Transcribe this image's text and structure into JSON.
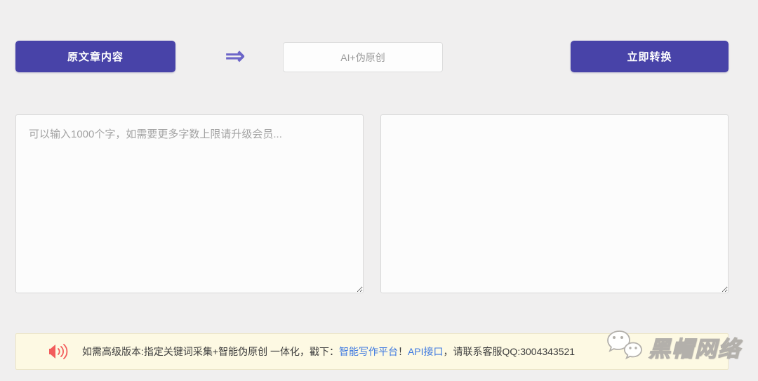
{
  "colors": {
    "page_background": "#f0efef",
    "primary_button": "#4843a8",
    "arrow": "#6c65c8",
    "mode_box_text": "#9b9b9b",
    "link": "#3e79e0",
    "speaker_icon": "#f25c5c",
    "notice_background": "#fdf9e3",
    "notice_border": "#ece5c5"
  },
  "header": {
    "source_button_label": "原文章内容",
    "arrow_glyph": "⇒",
    "mode_label": "AI+伪原创",
    "convert_button_label": "立即转换"
  },
  "editors": {
    "input_placeholder": "可以输入1000个字，如需要更多字数上限请升级会员...",
    "input_value": "",
    "output_value": ""
  },
  "notice": {
    "text_prefix": "如需高级版本:指定关键词采集+智能伪原创 一体化，戳下：",
    "link_platform": "智能写作平台",
    "separator": "！",
    "link_api": "API接口",
    "text_suffix": "，请联系客服QQ:3004343521"
  },
  "watermark": {
    "brand": "黑帽网络"
  }
}
